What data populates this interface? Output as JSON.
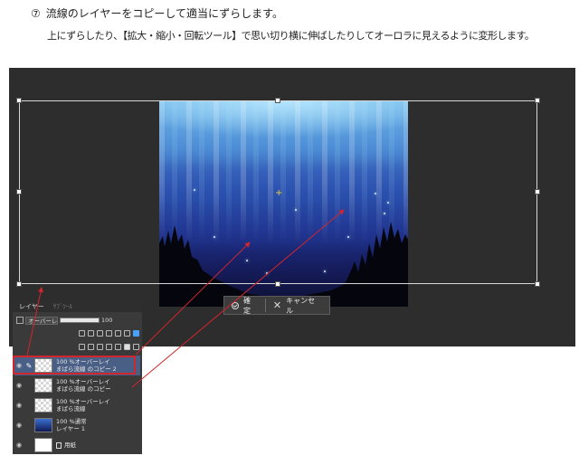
{
  "step": {
    "number": "⑦",
    "title": "流線のレイヤーをコピーして適当にずらします。",
    "instruction": "上にずらしたり、【拡大・縮小・回転ツール】で思い切り横に伸ばしたりしてオーロラに見えるように変形します。"
  },
  "colors": {
    "canvas_bg": "#2d2d2d",
    "highlight": "#d0262c",
    "arrow": "#d0262c",
    "selected_layer": "#4a5f86"
  },
  "transform_bar": {
    "confirm_label": "確定",
    "cancel_label": "キャンセル",
    "confirm_icon": "check-circle-icon",
    "cancel_icon": "x-icon"
  },
  "layer_panel": {
    "tabs": [
      "レイヤー",
      "ｻﾌﾞﾂｰﾙ"
    ],
    "blend_mode": "オーバーレイ",
    "opacity": "100",
    "layers": [
      {
        "line1": "100 %オーバーレイ",
        "line2": "まばら流線 のコピー 2",
        "selected": true
      },
      {
        "line1": "100 %オーバーレイ",
        "line2": "まばら流線 のコピー",
        "selected": false
      },
      {
        "line1": "100 %オーバーレイ",
        "line2": "まばら流線",
        "selected": false
      },
      {
        "line1": "100 %通常",
        "line2": "レイヤー 1",
        "selected": false
      },
      {
        "line1": "",
        "line2": "用紙",
        "selected": false
      }
    ]
  }
}
